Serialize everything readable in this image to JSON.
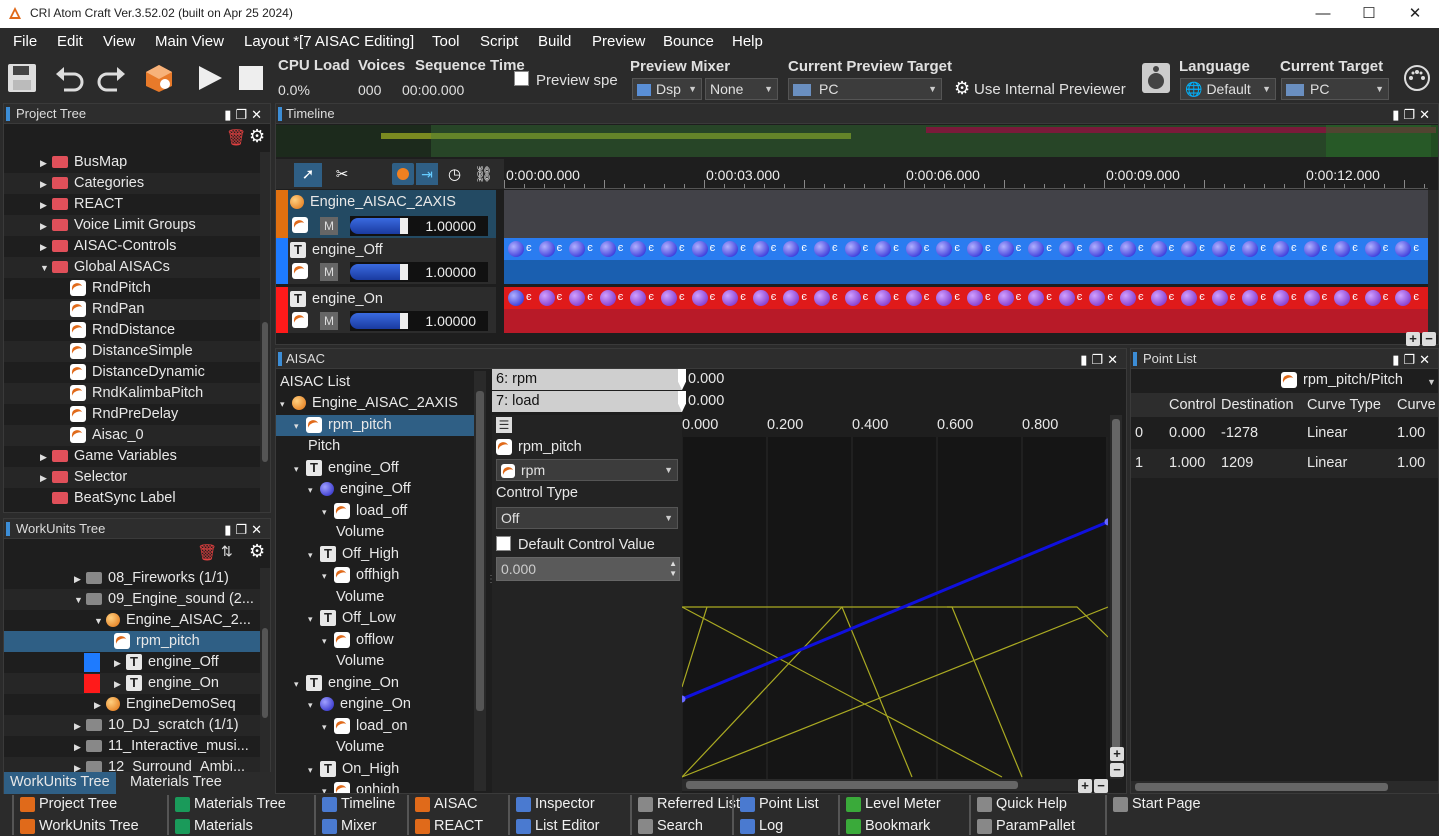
{
  "window": {
    "title": "CRI Atom Craft Ver.3.52.02 (built on Apr 25 2024)",
    "minimize": "—",
    "maximize": "☐",
    "close": "✕"
  },
  "menu": [
    "File",
    "Edit",
    "View",
    "Main View",
    "Layout *[7 AISAC Editing]",
    "Tool",
    "Script",
    "Build",
    "Preview",
    "Bounce",
    "Help"
  ],
  "toolbar": {
    "cpu_load_label": "CPU Load",
    "cpu_load_value": "0.0%",
    "voices_label": "Voices",
    "voices_value": "000",
    "sequence_time_label": "Sequence Time",
    "sequence_time_value": "00:00.000",
    "preview_spe_label": "Preview spe",
    "preview_mixer_label": "Preview Mixer",
    "mixer_dsp": "Dsp",
    "mixer_none": "None",
    "current_preview_target_label": "Current Preview Target",
    "preview_target_value": "PC",
    "use_internal_previewer": "Use Internal Previewer",
    "language_label": "Language",
    "language_value": "Default",
    "current_target_label": "Current Target",
    "current_target_value": "PC"
  },
  "project_tree": {
    "title": "Project Tree",
    "items": [
      {
        "label": "BusMap",
        "kind": "folder",
        "indent": 0,
        "expanded": false
      },
      {
        "label": "Categories",
        "kind": "folder",
        "indent": 0,
        "expanded": false
      },
      {
        "label": "REACT",
        "kind": "folder",
        "indent": 0,
        "expanded": false
      },
      {
        "label": "Voice Limit Groups",
        "kind": "folder",
        "indent": 0,
        "expanded": false
      },
      {
        "label": "AISAC-Controls",
        "kind": "folder",
        "indent": 0,
        "expanded": false
      },
      {
        "label": "Global AISACs",
        "kind": "folder",
        "indent": 0,
        "expanded": true
      },
      {
        "label": "RndPitch",
        "kind": "aisac",
        "indent": 1
      },
      {
        "label": "RndPan",
        "kind": "aisac",
        "indent": 1
      },
      {
        "label": "RndDistance",
        "kind": "aisac",
        "indent": 1
      },
      {
        "label": "DistanceSimple",
        "kind": "aisac",
        "indent": 1
      },
      {
        "label": "DistanceDynamic",
        "kind": "aisac",
        "indent": 1
      },
      {
        "label": "RndKalimbaPitch",
        "kind": "aisac",
        "indent": 1
      },
      {
        "label": "RndPreDelay",
        "kind": "aisac",
        "indent": 1
      },
      {
        "label": "Aisac_0",
        "kind": "aisac",
        "indent": 1
      },
      {
        "label": "Game Variables",
        "kind": "folder",
        "indent": 0,
        "expanded": false
      },
      {
        "label": "Selector",
        "kind": "folder",
        "indent": 0,
        "expanded": false
      },
      {
        "label": "BeatSync Label",
        "kind": "folder",
        "indent": 0,
        "expanded": null
      }
    ]
  },
  "workunits_tree": {
    "title": "WorkUnits Tree",
    "items": [
      {
        "label": "08_Fireworks (1/1)",
        "kind": "gfolder",
        "indent": 0
      },
      {
        "label": "09_Engine_sound (2...",
        "kind": "gfolder",
        "indent": 0
      },
      {
        "label": "Engine_AISAC_2...",
        "kind": "orange",
        "indent": 1
      },
      {
        "label": "rpm_pitch",
        "kind": "aisac",
        "indent": 2,
        "selected": true
      },
      {
        "label": "engine_Off",
        "kind": "track",
        "indent": 2,
        "color": "#1e7bff"
      },
      {
        "label": "engine_On",
        "kind": "track",
        "indent": 2,
        "color": "#ff1a1a"
      },
      {
        "label": "EngineDemoSeq",
        "kind": "orange",
        "indent": 1
      },
      {
        "label": "10_DJ_scratch (1/1)",
        "kind": "gfolder",
        "indent": 0
      },
      {
        "label": "11_Interactive_musi...",
        "kind": "gfolder",
        "indent": 0
      },
      {
        "label": "12_Surround_Ambi...",
        "kind": "gfolder",
        "indent": 0
      }
    ],
    "tabs": [
      "WorkUnits Tree",
      "Materials Tree"
    ]
  },
  "timeline": {
    "title": "Timeline",
    "ticks": [
      "0:00:00.000",
      "0:00:03.000",
      "0:00:06.000",
      "0:00:09.000",
      "0:00:12.000"
    ],
    "tracks": [
      {
        "name": "Engine_AISAC_2AXIS",
        "volume": "1.00000",
        "mute": "M",
        "color": "#e07010"
      },
      {
        "name": "engine_Off",
        "volume": "1.00000",
        "mute": "M",
        "color": "#1e7bff"
      },
      {
        "name": "engine_On",
        "volume": "1.00000",
        "mute": "M",
        "color": "#ff1a1a"
      }
    ]
  },
  "aisac": {
    "title": "AISAC",
    "list_title": "AISAC List",
    "list": [
      {
        "label": "Engine_AISAC_2AXIS",
        "kind": "orange",
        "indent": 0
      },
      {
        "label": "rpm_pitch",
        "kind": "aisac",
        "indent": 1,
        "selected": true
      },
      {
        "label": "Pitch",
        "kind": "text",
        "indent": 2
      },
      {
        "label": "engine_Off",
        "kind": "track",
        "indent": 1
      },
      {
        "label": "engine_Off",
        "kind": "blue",
        "indent": 2
      },
      {
        "label": "load_off",
        "kind": "aisac",
        "indent": 3
      },
      {
        "label": "Volume",
        "kind": "text",
        "indent": 4
      },
      {
        "label": "Off_High",
        "kind": "track",
        "indent": 2
      },
      {
        "label": "offhigh",
        "kind": "aisac",
        "indent": 3
      },
      {
        "label": "Volume",
        "kind": "text",
        "indent": 4
      },
      {
        "label": "Off_Low",
        "kind": "track",
        "indent": 2
      },
      {
        "label": "offlow",
        "kind": "aisac",
        "indent": 3
      },
      {
        "label": "Volume",
        "kind": "text",
        "indent": 4
      },
      {
        "label": "engine_On",
        "kind": "track",
        "indent": 1
      },
      {
        "label": "engine_On",
        "kind": "blue",
        "indent": 2
      },
      {
        "label": "load_on",
        "kind": "aisac",
        "indent": 3
      },
      {
        "label": "Volume",
        "kind": "text",
        "indent": 4
      },
      {
        "label": "On_High",
        "kind": "track",
        "indent": 2
      },
      {
        "label": "onhigh",
        "kind": "aisac",
        "indent": 3
      }
    ],
    "controls": [
      {
        "label": "6: rpm",
        "value": "0.000"
      },
      {
        "label": "7: load",
        "value": "0.000"
      }
    ],
    "props": {
      "name": "rpm_pitch",
      "control": "rpm",
      "control_type_label": "Control Type",
      "control_type": "Off",
      "default_control_label": "Default Control Value",
      "default_control_value": "0.000"
    },
    "graph_ticks": [
      "0.000",
      "0.200",
      "0.400",
      "0.600",
      "0.800"
    ],
    "graph": {
      "main_curve": [
        [
          0,
          -1278
        ],
        [
          1,
          1209
        ]
      ],
      "main_color": "#1010dd",
      "bg_color": "#aaaa22"
    }
  },
  "point_list": {
    "title": "Point List",
    "target": "rpm_pitch/Pitch",
    "columns": [
      "",
      "Control",
      "Destination",
      "Curve Type",
      "Curve S"
    ],
    "rows": [
      [
        "0",
        "0.000",
        "-1278",
        "Linear",
        "1.00"
      ],
      [
        "1",
        "1.000",
        "1209",
        "Linear",
        "1.00"
      ]
    ]
  },
  "dock": [
    {
      "top": "Project Tree",
      "bottom": "WorkUnits Tree"
    },
    {
      "top": "Materials Tree",
      "bottom": "Materials"
    },
    {
      "top": "Timeline",
      "bottom": "Mixer"
    },
    {
      "top": "AISAC",
      "bottom": "REACT"
    },
    {
      "top": "Inspector",
      "bottom": "List Editor"
    },
    {
      "top": "Referred List",
      "bottom": "Search"
    },
    {
      "top": "Point List",
      "bottom": "Log"
    },
    {
      "top": "Level Meter",
      "bottom": "Bookmark"
    },
    {
      "top": "Quick Help",
      "bottom": "ParamPallet"
    },
    {
      "top": "Start Page",
      "bottom": ""
    }
  ]
}
